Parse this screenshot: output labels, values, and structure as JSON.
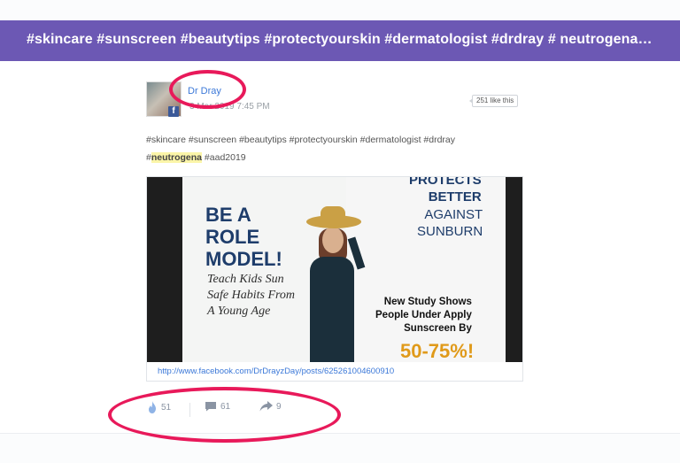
{
  "header": {
    "title": "#skincare #sunscreen #beautytips #protectyourskin #dermatologist #drdray # neutrogena #…"
  },
  "post": {
    "author": "Dr Dray",
    "timestamp": "3 Mar 2019 7:45 PM",
    "likes_badge": "251 like this",
    "caption_line1": "#skincare #sunscreen #beautytips #protectyourskin #dermatologist #drdray",
    "caption_hash": "#",
    "caption_highlight": "neutrogena",
    "caption_tail": " #aad2019",
    "media": {
      "be_a": "BE A",
      "role": "ROLE",
      "model": "MODEL!",
      "teach1": "Teach Kids Sun",
      "teach2": "Safe Habits From",
      "teach3": "A Young Age",
      "protects": "PROTECTS",
      "better": "BETTER",
      "against": "AGAINST",
      "sunburn": "SUNBURN",
      "study1": "New Study Shows",
      "study2": "People Under Apply",
      "study3": "Sunscreen By",
      "pct": "50-75%!"
    },
    "link_url": "http://www.facebook.com/DrDrayzDay/posts/625261004600910",
    "actions": {
      "reactions": "51",
      "comments": "61",
      "shares": "9"
    }
  },
  "colors": {
    "header_bg": "#6c58b4",
    "annotation": "#e8195a",
    "link": "#3b78d8",
    "highlight": "#fbf5a8"
  },
  "icons": [
    "facebook-icon",
    "fire-icon",
    "comment-icon",
    "share-icon"
  ]
}
